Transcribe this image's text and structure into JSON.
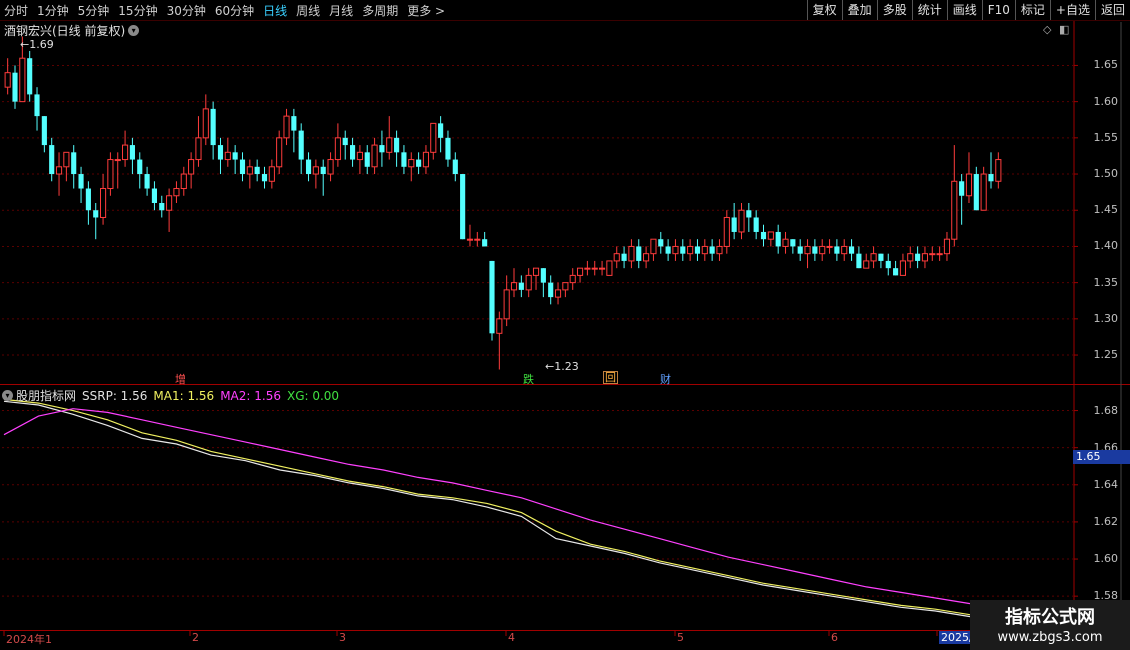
{
  "toolbar": {
    "periods": [
      "分时",
      "1分钟",
      "5分钟",
      "15分钟",
      "30分钟",
      "60分钟",
      "日线",
      "周线",
      "月线",
      "多周期",
      "更多 >"
    ],
    "active_period": "日线",
    "actions": [
      "复权",
      "叠加",
      "多股",
      "统计",
      "画线",
      "F10",
      "标记",
      "+自选",
      "返回"
    ]
  },
  "main_panel": {
    "title": "酒钢宏兴(日线 前复权)",
    "high_label": "1.69",
    "low_label": "1.23",
    "y_ticks": [
      "1.65",
      "1.60",
      "1.55",
      "1.50",
      "1.45",
      "1.40",
      "1.35",
      "1.30",
      "1.25"
    ],
    "signals": [
      {
        "text": "增",
        "color": "#ff5050"
      },
      {
        "text": "跌",
        "color": "#40e040"
      },
      {
        "text": "回",
        "color": "#ffb040"
      },
      {
        "text": "财",
        "color": "#60a0ff"
      }
    ]
  },
  "indicator_panel": {
    "name": "股朋指标网",
    "values": [
      {
        "label": "SSRP: 1.56",
        "color": "#e0e0e0"
      },
      {
        "label": "MA1: 1.56",
        "color": "#f0f060"
      },
      {
        "label": "MA2: 1.56",
        "color": "#ff40ff"
      },
      {
        "label": "XG: 0.00",
        "color": "#40e040"
      }
    ],
    "y_ticks": [
      "1.68",
      "1.66",
      "1.64",
      "1.62",
      "1.60",
      "1.58"
    ],
    "cursor_value": "1.65"
  },
  "x_axis": {
    "labels": [
      "2024年1",
      "2",
      "3",
      "4",
      "5",
      "6",
      "2025/0"
    ]
  },
  "watermark": {
    "line1": "指标公式网",
    "line2": "www.zbgs3.com"
  },
  "colors": {
    "up": "#ff3c3c",
    "down": "#54ffff",
    "grid": "#5a0000",
    "border": "#a00000"
  },
  "chart_data": [
    {
      "type": "candlestick",
      "title": "酒钢宏兴(日线 前复权)",
      "ylim": [
        1.21,
        1.71
      ],
      "high_marker": 1.69,
      "low_marker": 1.23,
      "candles": [
        [
          1.62,
          1.64,
          1.66,
          1.61
        ],
        [
          1.64,
          1.6,
          1.65,
          1.59
        ],
        [
          1.6,
          1.66,
          1.69,
          1.6
        ],
        [
          1.66,
          1.61,
          1.67,
          1.6
        ],
        [
          1.61,
          1.58,
          1.62,
          1.56
        ],
        [
          1.58,
          1.54,
          1.58,
          1.53
        ],
        [
          1.54,
          1.5,
          1.55,
          1.49
        ],
        [
          1.5,
          1.51,
          1.53,
          1.47
        ],
        [
          1.51,
          1.53,
          1.53,
          1.49
        ],
        [
          1.53,
          1.5,
          1.54,
          1.48
        ],
        [
          1.5,
          1.48,
          1.51,
          1.46
        ],
        [
          1.48,
          1.45,
          1.49,
          1.43
        ],
        [
          1.45,
          1.44,
          1.46,
          1.41
        ],
        [
          1.44,
          1.48,
          1.5,
          1.43
        ],
        [
          1.48,
          1.52,
          1.53,
          1.47
        ],
        [
          1.52,
          1.52,
          1.53,
          1.48
        ],
        [
          1.52,
          1.54,
          1.56,
          1.51
        ],
        [
          1.54,
          1.52,
          1.55,
          1.5
        ],
        [
          1.52,
          1.5,
          1.53,
          1.48
        ],
        [
          1.5,
          1.48,
          1.51,
          1.47
        ],
        [
          1.48,
          1.46,
          1.49,
          1.45
        ],
        [
          1.46,
          1.45,
          1.47,
          1.44
        ],
        [
          1.45,
          1.47,
          1.48,
          1.42
        ],
        [
          1.47,
          1.48,
          1.49,
          1.46
        ],
        [
          1.48,
          1.5,
          1.51,
          1.47
        ],
        [
          1.5,
          1.52,
          1.53,
          1.48
        ],
        [
          1.52,
          1.55,
          1.58,
          1.51
        ],
        [
          1.55,
          1.59,
          1.61,
          1.54
        ],
        [
          1.59,
          1.54,
          1.6,
          1.52
        ],
        [
          1.54,
          1.52,
          1.55,
          1.5
        ],
        [
          1.52,
          1.53,
          1.55,
          1.51
        ],
        [
          1.53,
          1.52,
          1.54,
          1.5
        ],
        [
          1.52,
          1.5,
          1.53,
          1.49
        ],
        [
          1.5,
          1.51,
          1.52,
          1.48
        ],
        [
          1.51,
          1.5,
          1.52,
          1.49
        ],
        [
          1.5,
          1.49,
          1.51,
          1.48
        ],
        [
          1.49,
          1.51,
          1.52,
          1.48
        ],
        [
          1.51,
          1.55,
          1.56,
          1.5
        ],
        [
          1.55,
          1.58,
          1.59,
          1.54
        ],
        [
          1.58,
          1.56,
          1.59,
          1.53
        ],
        [
          1.56,
          1.52,
          1.57,
          1.5
        ],
        [
          1.52,
          1.5,
          1.53,
          1.49
        ],
        [
          1.5,
          1.51,
          1.52,
          1.48
        ],
        [
          1.51,
          1.5,
          1.52,
          1.47
        ],
        [
          1.5,
          1.52,
          1.53,
          1.49
        ],
        [
          1.52,
          1.55,
          1.57,
          1.51
        ],
        [
          1.55,
          1.54,
          1.56,
          1.52
        ],
        [
          1.54,
          1.52,
          1.55,
          1.51
        ],
        [
          1.52,
          1.53,
          1.54,
          1.5
        ],
        [
          1.53,
          1.51,
          1.54,
          1.5
        ],
        [
          1.51,
          1.54,
          1.55,
          1.5
        ],
        [
          1.54,
          1.53,
          1.56,
          1.51
        ],
        [
          1.53,
          1.55,
          1.58,
          1.52
        ],
        [
          1.55,
          1.53,
          1.56,
          1.51
        ],
        [
          1.53,
          1.51,
          1.54,
          1.5
        ],
        [
          1.51,
          1.52,
          1.53,
          1.49
        ],
        [
          1.52,
          1.51,
          1.53,
          1.5
        ],
        [
          1.51,
          1.53,
          1.54,
          1.5
        ],
        [
          1.53,
          1.57,
          1.57,
          1.52
        ],
        [
          1.57,
          1.55,
          1.58,
          1.53
        ],
        [
          1.55,
          1.52,
          1.56,
          1.51
        ],
        [
          1.52,
          1.5,
          1.53,
          1.49
        ],
        [
          1.5,
          1.41,
          1.5,
          1.41
        ],
        [
          1.41,
          1.41,
          1.43,
          1.4
        ],
        [
          1.41,
          1.41,
          1.42,
          1.4
        ],
        [
          1.41,
          1.4,
          1.42,
          1.4
        ],
        [
          1.38,
          1.28,
          1.38,
          1.27
        ],
        [
          1.28,
          1.3,
          1.31,
          1.23
        ],
        [
          1.3,
          1.34,
          1.36,
          1.29
        ],
        [
          1.34,
          1.35,
          1.37,
          1.33
        ],
        [
          1.35,
          1.34,
          1.36,
          1.33
        ],
        [
          1.34,
          1.36,
          1.37,
          1.33
        ],
        [
          1.36,
          1.37,
          1.37,
          1.34
        ],
        [
          1.37,
          1.35,
          1.37,
          1.33
        ],
        [
          1.35,
          1.33,
          1.36,
          1.32
        ],
        [
          1.33,
          1.34,
          1.35,
          1.32
        ],
        [
          1.34,
          1.35,
          1.35,
          1.33
        ],
        [
          1.35,
          1.36,
          1.37,
          1.34
        ],
        [
          1.36,
          1.37,
          1.37,
          1.35
        ],
        [
          1.37,
          1.37,
          1.38,
          1.36
        ],
        [
          1.37,
          1.37,
          1.38,
          1.36
        ],
        [
          1.37,
          1.37,
          1.38,
          1.36
        ],
        [
          1.36,
          1.38,
          1.38,
          1.36
        ],
        [
          1.38,
          1.39,
          1.4,
          1.37
        ],
        [
          1.39,
          1.38,
          1.4,
          1.37
        ],
        [
          1.38,
          1.4,
          1.41,
          1.37
        ],
        [
          1.4,
          1.38,
          1.41,
          1.37
        ],
        [
          1.38,
          1.39,
          1.4,
          1.37
        ],
        [
          1.39,
          1.41,
          1.41,
          1.38
        ],
        [
          1.41,
          1.4,
          1.42,
          1.39
        ],
        [
          1.4,
          1.39,
          1.41,
          1.38
        ],
        [
          1.39,
          1.4,
          1.41,
          1.38
        ],
        [
          1.4,
          1.39,
          1.41,
          1.38
        ],
        [
          1.39,
          1.4,
          1.41,
          1.38
        ],
        [
          1.4,
          1.39,
          1.41,
          1.38
        ],
        [
          1.39,
          1.4,
          1.41,
          1.38
        ],
        [
          1.4,
          1.39,
          1.41,
          1.38
        ],
        [
          1.39,
          1.4,
          1.41,
          1.38
        ],
        [
          1.4,
          1.44,
          1.45,
          1.39
        ],
        [
          1.44,
          1.42,
          1.46,
          1.41
        ],
        [
          1.42,
          1.45,
          1.46,
          1.41
        ],
        [
          1.45,
          1.44,
          1.46,
          1.42
        ],
        [
          1.44,
          1.42,
          1.45,
          1.41
        ],
        [
          1.42,
          1.41,
          1.43,
          1.4
        ],
        [
          1.41,
          1.42,
          1.42,
          1.4
        ],
        [
          1.42,
          1.4,
          1.43,
          1.39
        ],
        [
          1.4,
          1.41,
          1.42,
          1.39
        ],
        [
          1.41,
          1.4,
          1.41,
          1.39
        ],
        [
          1.4,
          1.39,
          1.41,
          1.38
        ],
        [
          1.39,
          1.4,
          1.41,
          1.37
        ],
        [
          1.4,
          1.39,
          1.41,
          1.38
        ],
        [
          1.39,
          1.4,
          1.41,
          1.38
        ],
        [
          1.4,
          1.4,
          1.41,
          1.39
        ],
        [
          1.4,
          1.39,
          1.41,
          1.38
        ],
        [
          1.39,
          1.4,
          1.41,
          1.38
        ],
        [
          1.4,
          1.39,
          1.41,
          1.38
        ],
        [
          1.39,
          1.37,
          1.4,
          1.37
        ],
        [
          1.37,
          1.38,
          1.39,
          1.37
        ],
        [
          1.38,
          1.39,
          1.4,
          1.37
        ],
        [
          1.39,
          1.38,
          1.39,
          1.37
        ],
        [
          1.38,
          1.37,
          1.39,
          1.36
        ],
        [
          1.37,
          1.36,
          1.38,
          1.36
        ],
        [
          1.36,
          1.38,
          1.39,
          1.36
        ],
        [
          1.38,
          1.39,
          1.4,
          1.37
        ],
        [
          1.39,
          1.38,
          1.4,
          1.37
        ],
        [
          1.38,
          1.39,
          1.4,
          1.37
        ],
        [
          1.39,
          1.39,
          1.4,
          1.38
        ],
        [
          1.39,
          1.39,
          1.4,
          1.38
        ],
        [
          1.39,
          1.41,
          1.42,
          1.38
        ],
        [
          1.41,
          1.49,
          1.54,
          1.4
        ],
        [
          1.49,
          1.47,
          1.5,
          1.43
        ],
        [
          1.47,
          1.5,
          1.53,
          1.46
        ],
        [
          1.5,
          1.45,
          1.51,
          1.45
        ],
        [
          1.45,
          1.5,
          1.51,
          1.45
        ],
        [
          1.5,
          1.49,
          1.53,
          1.48
        ],
        [
          1.49,
          1.52,
          1.53,
          1.48
        ]
      ]
    },
    {
      "type": "line",
      "title": "股朋指标网",
      "ylim": [
        1.565,
        1.69
      ],
      "series": [
        {
          "name": "SSRP",
          "color": "#e8e8e8",
          "values": [
            1.685,
            1.683,
            1.678,
            1.672,
            1.665,
            1.662,
            1.656,
            1.653,
            1.648,
            1.645,
            1.641,
            1.638,
            1.634,
            1.632,
            1.628,
            1.623,
            1.611,
            1.607,
            1.603,
            1.598,
            1.594,
            1.59,
            1.586,
            1.583,
            1.58,
            1.577,
            1.574,
            1.572,
            1.569
          ]
        },
        {
          "name": "MA1",
          "color": "#f0f060",
          "values": [
            1.686,
            1.684,
            1.68,
            1.675,
            1.668,
            1.664,
            1.658,
            1.654,
            1.65,
            1.646,
            1.642,
            1.639,
            1.635,
            1.633,
            1.63,
            1.625,
            1.615,
            1.608,
            1.604,
            1.599,
            1.595,
            1.591,
            1.587,
            1.584,
            1.581,
            1.578,
            1.575,
            1.573,
            1.57
          ]
        },
        {
          "name": "MA2",
          "color": "#ff40ff",
          "values": [
            1.667,
            1.677,
            1.681,
            1.679,
            1.675,
            1.671,
            1.667,
            1.663,
            1.659,
            1.655,
            1.651,
            1.648,
            1.644,
            1.641,
            1.637,
            1.633,
            1.627,
            1.621,
            1.616,
            1.611,
            1.606,
            1.601,
            1.597,
            1.593,
            1.589,
            1.585,
            1.582,
            1.579,
            1.576
          ]
        }
      ]
    }
  ]
}
